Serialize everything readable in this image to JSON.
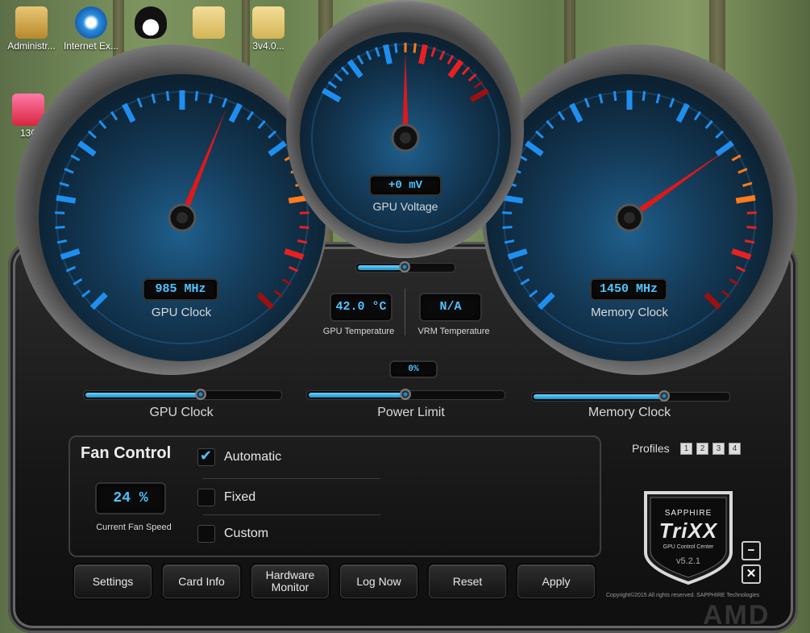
{
  "desktop": {
    "icons": [
      {
        "label": "Administr..."
      },
      {
        "label": "Internet Ex..."
      },
      {
        "label": ""
      },
      {
        "label": ""
      },
      {
        "label": "3v4.0..."
      },
      {
        "label": "130"
      }
    ]
  },
  "gauges": {
    "gpu_clock": {
      "value": "985 MHz",
      "label": "GPU Clock"
    },
    "gpu_voltage": {
      "value": "+0 mV",
      "label": "GPU Voltage"
    },
    "memory_clock": {
      "value": "1450 MHz",
      "label": "Memory Clock"
    }
  },
  "temps": {
    "gpu_temp": {
      "value": "42.0 °C",
      "label": "GPU Temperature"
    },
    "vrm_temp": {
      "value": "N/A",
      "label": "VRM Temperature"
    }
  },
  "sliders": {
    "voltage_fraction": 0.5,
    "power_limit_readout": "0%",
    "gpu_clock": {
      "label": "GPU Clock",
      "fraction": 0.6
    },
    "power_limit": {
      "label": "Power Limit",
      "fraction": 0.5
    },
    "memory_clock": {
      "label": "Memory Clock",
      "fraction": 0.68
    }
  },
  "fan": {
    "title": "Fan Control",
    "speed": "24 %",
    "speed_label": "Current Fan Speed",
    "options": [
      {
        "label": "Automatic",
        "checked": true
      },
      {
        "label": "Fixed",
        "checked": false
      },
      {
        "label": "Custom",
        "checked": false
      }
    ]
  },
  "profiles": {
    "label": "Profiles",
    "items": [
      "1",
      "2",
      "3",
      "4"
    ]
  },
  "buttons": {
    "settings": "Settings",
    "card_info": "Card Info",
    "hardware_monitor_line1": "Hardware",
    "hardware_monitor_line2": "Monitor",
    "log_now": "Log Now",
    "reset": "Reset",
    "apply": "Apply"
  },
  "brand": {
    "maker": "SAPPHIRE",
    "product": "TriXX",
    "subtitle": "GPU Control Center",
    "version": "v5.2.1",
    "copyright": "Copyright©2015 All rights reserved. SAPPHIRE Technologies",
    "watermark": "AMD"
  },
  "window": {
    "minimize": "−",
    "close": "✕"
  },
  "colors": {
    "accent": "#4fc3ff",
    "needle": "#e01818",
    "scale_hot": "#e8421a"
  }
}
